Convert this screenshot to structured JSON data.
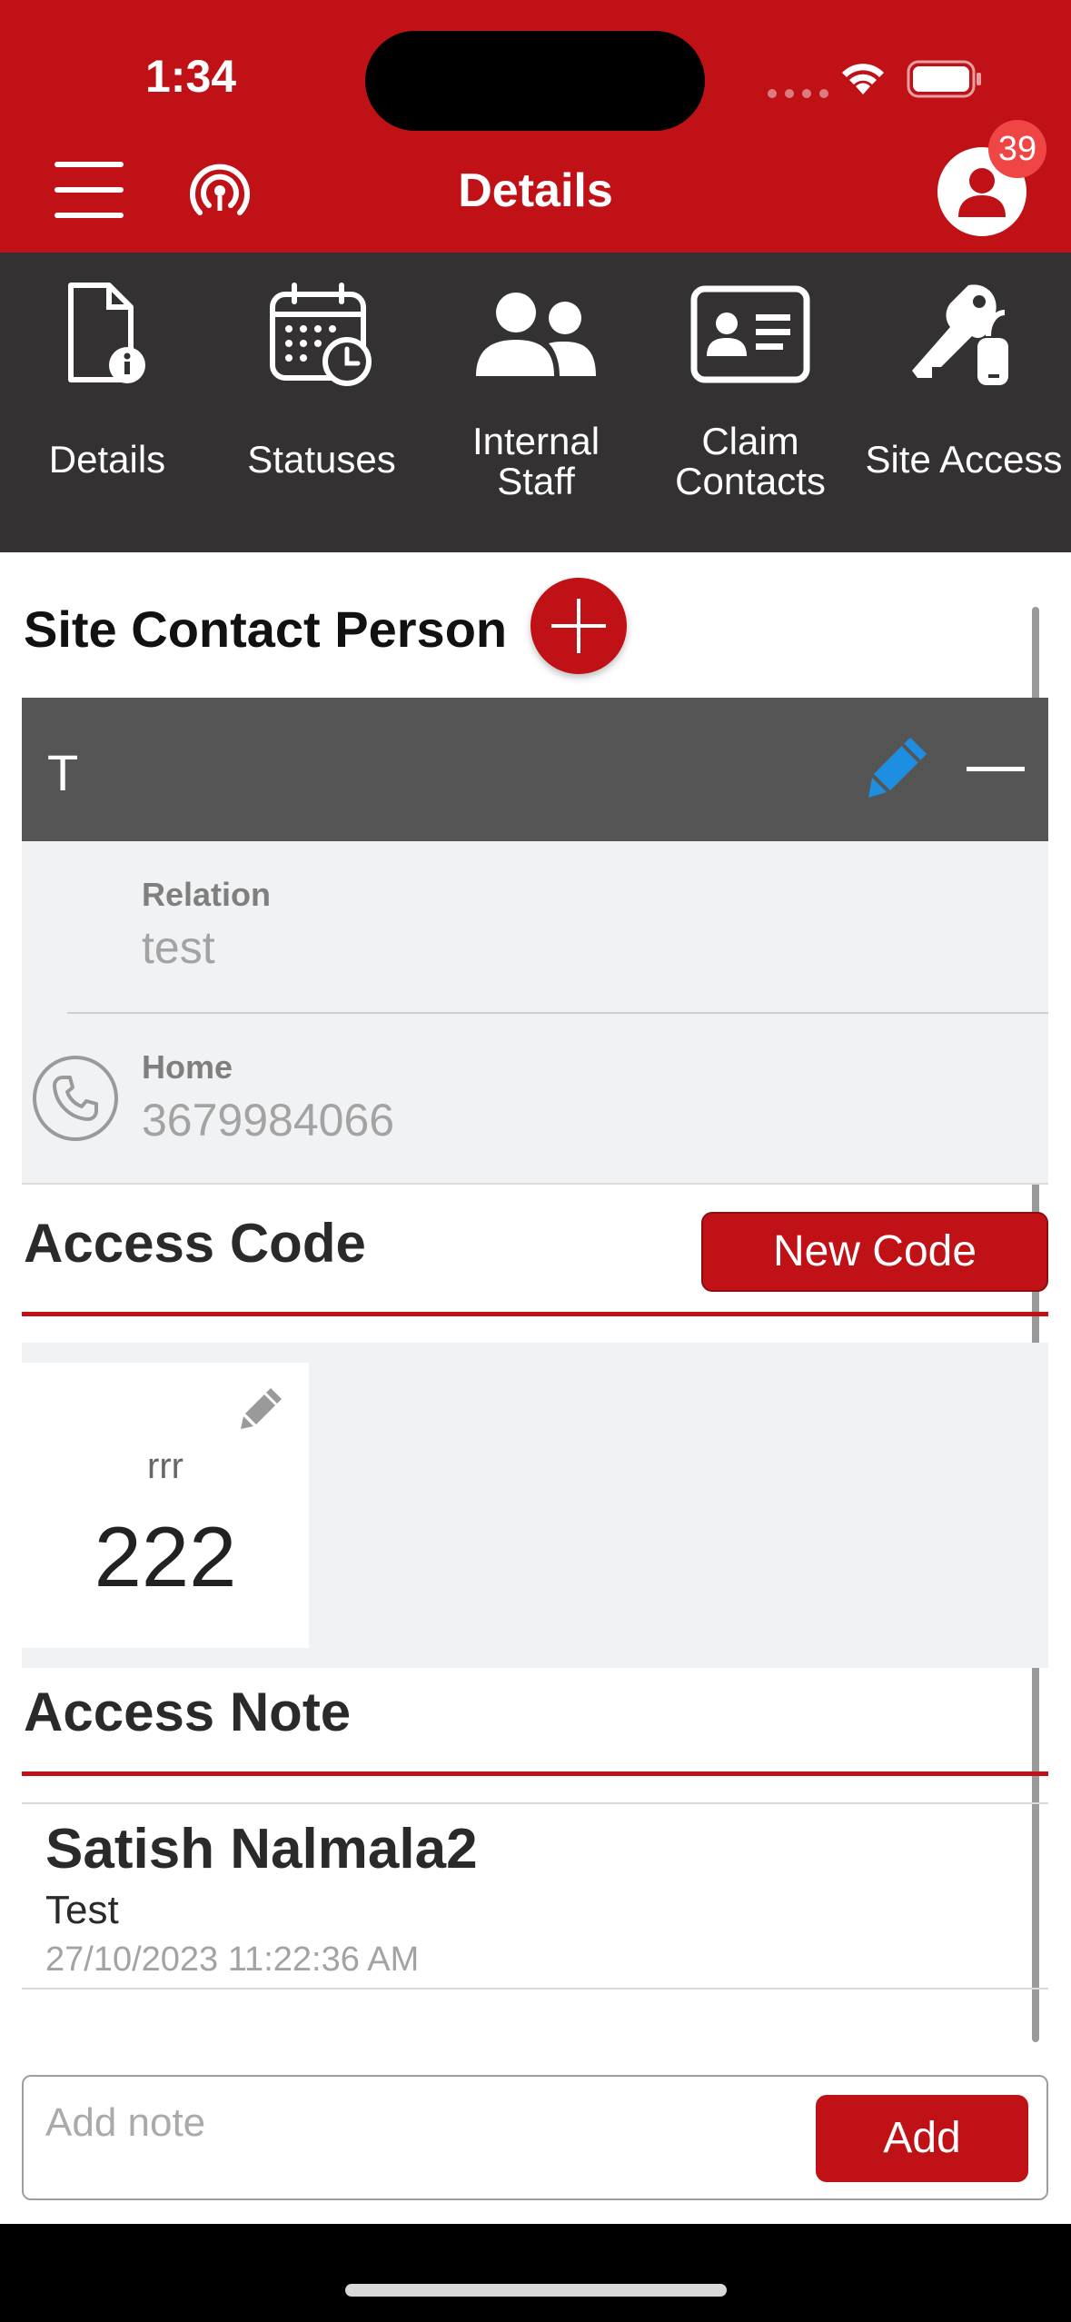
{
  "status_bar": {
    "time": "1:34"
  },
  "header": {
    "title": "Details",
    "notification_count": "39",
    "menu_icon": "hamburger-icon",
    "broadcast_icon": "broadcast-icon",
    "profile_icon": "user-icon"
  },
  "tabs": [
    {
      "label_line1": "Details",
      "label_line2": "",
      "icon": "document-info-icon"
    },
    {
      "label_line1": "Statuses",
      "label_line2": "",
      "icon": "calendar-clock-icon"
    },
    {
      "label_line1": "Internal",
      "label_line2": "Staff",
      "icon": "users-icon"
    },
    {
      "label_line1": "Claim",
      "label_line2": "Contacts",
      "icon": "contact-card-icon"
    },
    {
      "label_line1": "Site Access",
      "label_line2": "",
      "icon": "keys-icon"
    }
  ],
  "active_tab": "Site Access",
  "site_contact": {
    "title": "Site Contact Person",
    "name": "T",
    "relation_label": "Relation",
    "relation_value": "test",
    "phone_label": "Home",
    "phone_value": "3679984066"
  },
  "access_code": {
    "title": "Access Code",
    "new_code_label": "New Code",
    "codes": [
      {
        "name": "rrr",
        "value": "222"
      }
    ]
  },
  "access_note": {
    "title": "Access Note",
    "notes": [
      {
        "author": "Satish Nalmala2",
        "text": "Test",
        "timestamp": "27/10/2023 11:22:36 AM"
      }
    ],
    "input_placeholder": "Add note",
    "add_label": "Add"
  },
  "colors": {
    "brand": "#c01117",
    "tabbar": "#333131",
    "edit_blue": "#1e8fe0"
  }
}
